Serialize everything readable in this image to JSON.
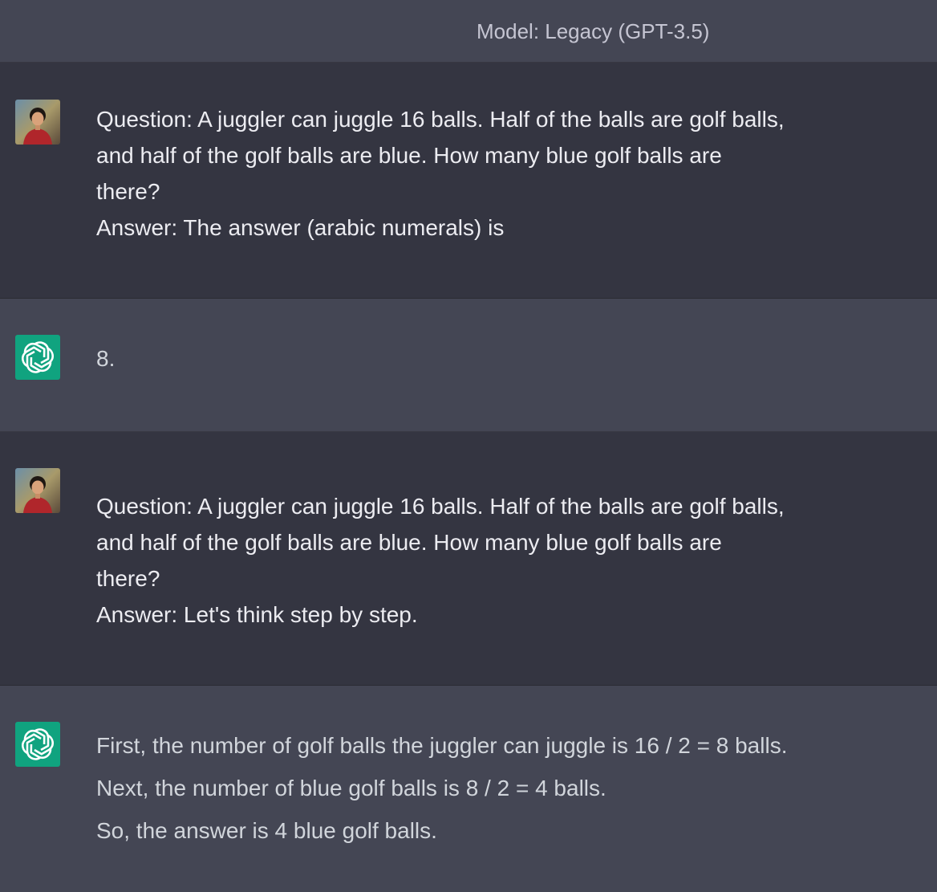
{
  "header": {
    "model_label": "Model: Legacy (GPT-3.5)"
  },
  "conversation": [
    {
      "role": "user",
      "avatar_icon": "user-photo-avatar",
      "lines": [
        "Question: A juggler can juggle 16 balls. Half of the balls are golf balls,",
        "and half of the golf balls are blue. How many blue golf balls are",
        "there?",
        "Answer: The answer (arabic numerals) is"
      ]
    },
    {
      "role": "assistant",
      "avatar_icon": "openai-logo-icon",
      "lines": [
        "8."
      ]
    },
    {
      "role": "user",
      "avatar_icon": "user-photo-avatar",
      "lines": [
        "Question: A juggler can juggle 16 balls. Half of the balls are golf balls,",
        "and half of the golf balls are blue. How many blue golf balls are",
        "there?",
        "Answer: Let's think step by step."
      ]
    },
    {
      "role": "assistant",
      "avatar_icon": "openai-logo-icon",
      "lines": [
        "First, the number of golf balls the juggler can juggle is 16 / 2 = 8 balls.",
        "Next, the number of blue golf balls is 8 / 2 = 4 balls.",
        "So, the answer is 4 blue golf balls."
      ]
    }
  ],
  "colors": {
    "user_bg": "#343541",
    "assistant_bg": "#444654",
    "logo_green": "#10a37f"
  }
}
